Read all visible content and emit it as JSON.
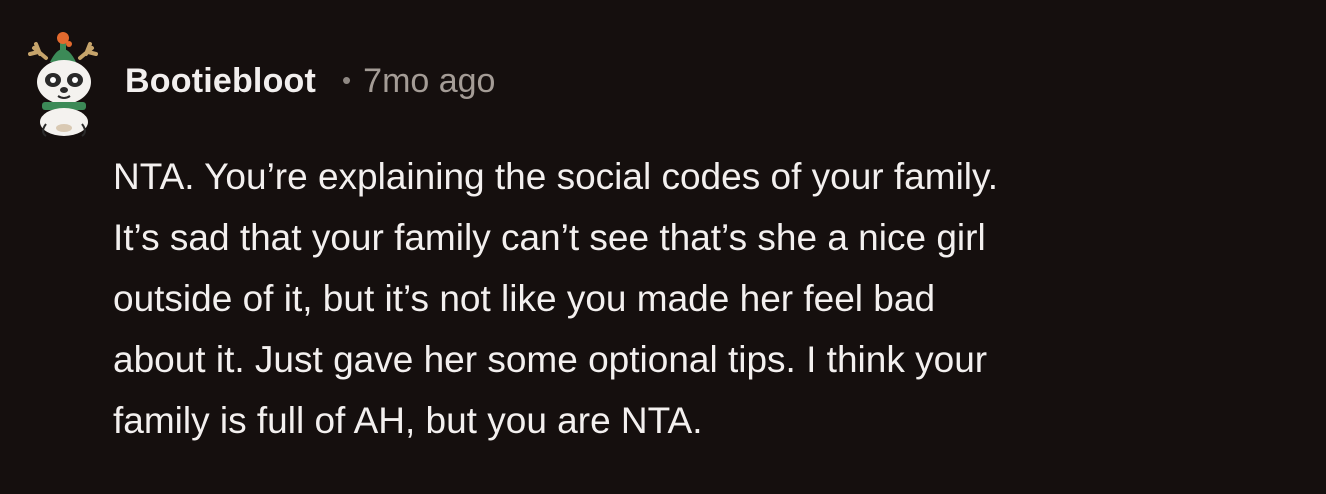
{
  "colors": {
    "background": "#150f0e",
    "username": "#f2efee",
    "meta": "#a49c96",
    "body_text": "#f3f0ef",
    "avatar_hat": "#3c8a57",
    "avatar_antler": "#c6a46b",
    "avatar_scarf": "#3c8a57",
    "avatar_pompom": "#e36a2e"
  },
  "comment": {
    "avatar_icon": "snoo-avatar-icon",
    "username": "Bootiebloot",
    "separator": "•",
    "timestamp": "7mo ago",
    "body_lines": [
      "NTA. You’re explaining the social codes of your family.",
      "It’s sad that your family can’t see that’s she a nice girl",
      "outside of it, but it’s not like you made her feel bad",
      "about it. Just gave her some optional tips. I think your",
      "family is full of AH, but you are NTA."
    ]
  }
}
